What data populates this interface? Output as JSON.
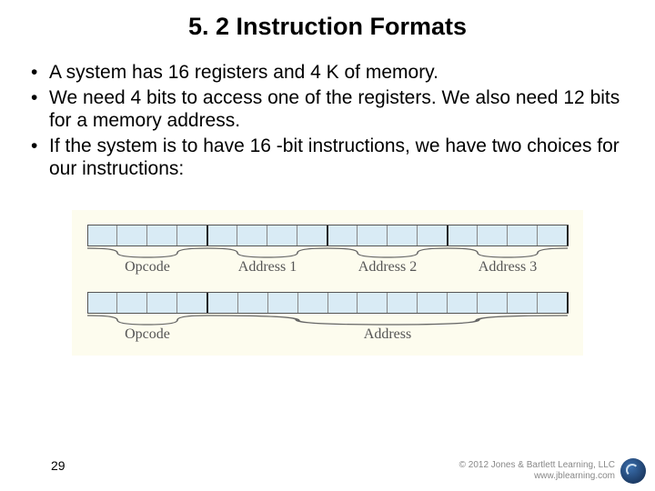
{
  "title": "5. 2 Instruction Formats",
  "bullets": [
    "A system has 16 registers and 4 K of memory.",
    "We need 4 bits to access one of the registers. We also need 12 bits for a memory address.",
    "If the system is to have 16 -bit instructions, we have two choices for our instructions:"
  ],
  "diagram": {
    "row1": {
      "total_bits": 16,
      "groups": [
        {
          "label": "Opcode",
          "bits": 4
        },
        {
          "label": "Address 1",
          "bits": 4
        },
        {
          "label": "Address 2",
          "bits": 4
        },
        {
          "label": "Address 3",
          "bits": 4
        }
      ]
    },
    "row2": {
      "total_bits": 16,
      "groups": [
        {
          "label": "Opcode",
          "bits": 4
        },
        {
          "label": "Address",
          "bits": 12
        }
      ]
    }
  },
  "page_number": "29",
  "footer": {
    "line1": "© 2012 Jones & Bartlett Learning, LLC",
    "line2": "www.jblearning.com"
  }
}
